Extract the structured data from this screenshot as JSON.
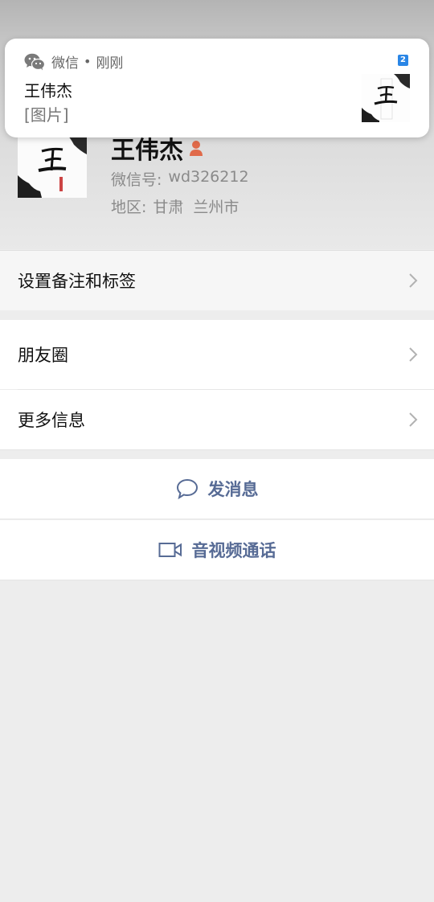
{
  "profile": {
    "name": "王伟杰",
    "wechat_id_label": "微信号:",
    "wechat_id": "wd326212",
    "region_label": "地区:",
    "region_province": "甘肃",
    "region_city": "兰州市"
  },
  "rows": {
    "remark": "设置备注和标签",
    "moments": "朋友圈",
    "more": "更多信息"
  },
  "actions": {
    "message": "发消息",
    "video_call": "音视频通话"
  },
  "notification": {
    "app": "微信",
    "separator": "•",
    "time": "刚刚",
    "sender": "王伟杰",
    "body": "[图片]",
    "badge": "2",
    "icon": "wechat-icon"
  },
  "colors": {
    "link": "#576b95",
    "background": "#ededed",
    "badge": "#2a86e6"
  }
}
